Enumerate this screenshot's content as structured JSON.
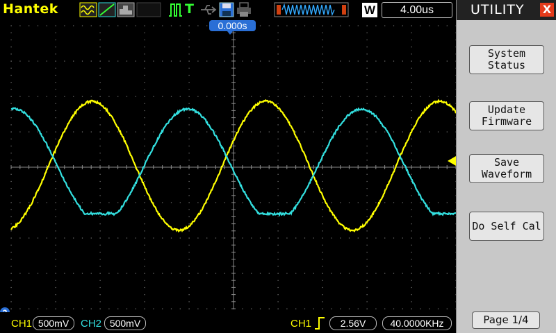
{
  "brand": "Hantek",
  "header": {
    "trigger_mode_letter": "T",
    "timebase_window_letter": "W",
    "timebase": "4.00us",
    "trigger_position": "0.000s"
  },
  "panel": {
    "title": "UTILITY",
    "close_symbol": "X",
    "buttons": [
      {
        "label": "System\nStatus"
      },
      {
        "label": "Update\nFirmware"
      },
      {
        "label": "Save\nWaveform"
      },
      {
        "label": "Do Self Cal"
      }
    ],
    "page": "Page 1/4"
  },
  "channels": {
    "ch1_label": "CH1",
    "ch1_scale": "500mV",
    "ch2_label": "CH2",
    "ch2_scale": "500mV",
    "ch2_marker": "2"
  },
  "trigger": {
    "source": "CH1",
    "level": "2.56V",
    "frequency": "40.0000KHz"
  },
  "colors": {
    "ch1": "#ffff00",
    "ch2": "#33e0e0",
    "accent_blue": "#2a6fd6",
    "close_red": "#e43b1b"
  },
  "icons": [
    "save-icon",
    "print-icon",
    "waveform-icon",
    "pulse-icon"
  ]
}
